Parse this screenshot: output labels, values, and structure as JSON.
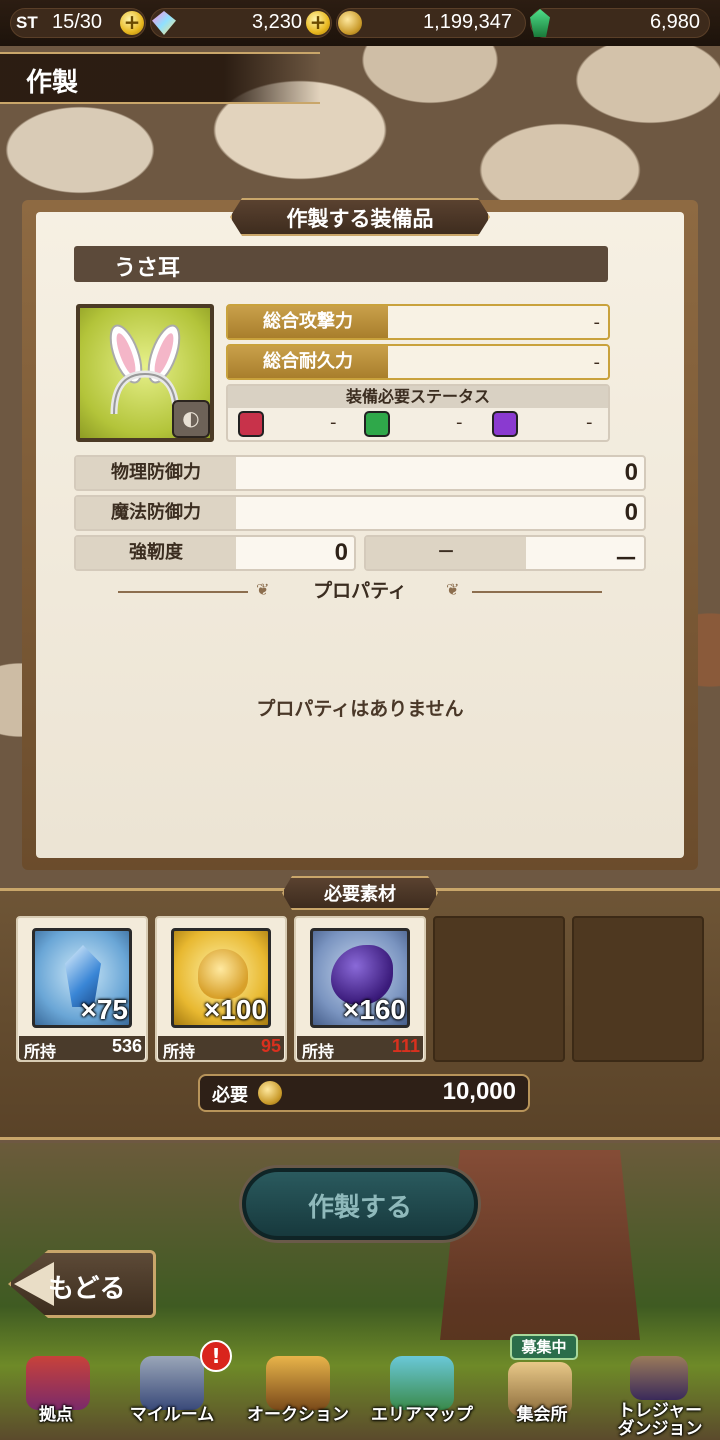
{
  "status_bar": {
    "st_label": "ST",
    "st_value": "15/30",
    "gems": "3,230",
    "gold": "1,199,347",
    "emerald": "6,980"
  },
  "header": {
    "title": "作製"
  },
  "panel": {
    "title": "作製する装備品",
    "item_name": "うさ耳",
    "stats": [
      {
        "label": "総合攻撃力",
        "value": "-"
      },
      {
        "label": "総合耐久力",
        "value": "-"
      }
    ],
    "required_status": {
      "label": "装備必要ステータス",
      "values": [
        "-",
        "-",
        "-"
      ]
    },
    "defense": [
      {
        "label": "物理防御力",
        "value": "0"
      },
      {
        "label": "魔法防御力",
        "value": "0"
      }
    ],
    "toughness": {
      "label": "強靭度",
      "value": "0",
      "extra_label": "－",
      "extra_value": "－"
    },
    "property_title": "プロパティ",
    "property_empty": "プロパティはありません"
  },
  "materials": {
    "title": "必要素材",
    "items": [
      {
        "icon": "blue-crystal-icon",
        "qty": "×75",
        "own_label": "所持",
        "own": "536",
        "own_color": "#ffffff"
      },
      {
        "icon": "golden-fur-icon",
        "qty": "×100",
        "own_label": "所持",
        "own": "95",
        "own_color": "#d9301e"
      },
      {
        "icon": "purple-scale-icon",
        "qty": "×160",
        "own_label": "所持",
        "own": "111",
        "own_color": "#d9301e"
      }
    ],
    "cost_label": "必要",
    "cost_value": "10,000"
  },
  "actions": {
    "craft": "作製する",
    "back": "もどる"
  },
  "nav": {
    "items": [
      {
        "label": "拠点",
        "icon": "base-icon"
      },
      {
        "label": "マイルーム",
        "icon": "my-room-icon",
        "alert": "!"
      },
      {
        "label": "オークション",
        "icon": "auction-hammer-icon"
      },
      {
        "label": "エリアマップ",
        "icon": "area-map-icon"
      },
      {
        "label": "集会所",
        "icon": "gathering-hall-icon",
        "tag": "募集中"
      },
      {
        "label": "トレジャー\nダンジョン",
        "label_line1": "トレジャー",
        "label_line2": "ダンジョン",
        "icon": "treasure-dungeon-icon"
      }
    ]
  },
  "colors": {
    "accent_gold": "#c9a04a",
    "panel_bg": "#f6f0e3",
    "insufficient": "#d9301e"
  }
}
